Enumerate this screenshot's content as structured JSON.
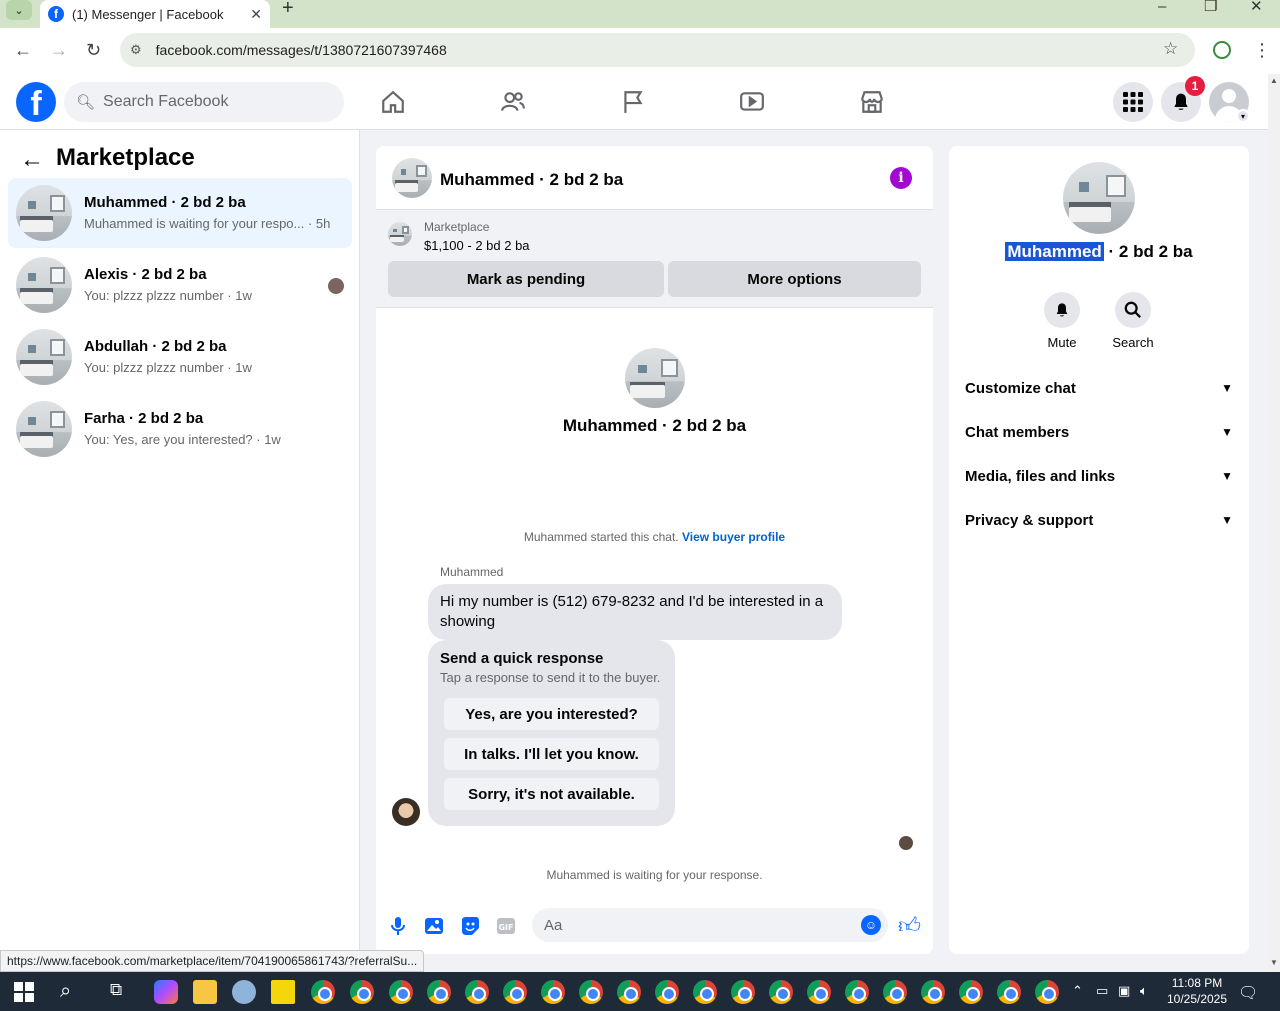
{
  "browser": {
    "tab_title": "(1) Messenger | Facebook",
    "tab_close": "✕",
    "new_tab": "+",
    "url": "facebook.com/messages/t/1380721607397468",
    "status_url": "https://www.facebook.com/marketplace/item/704190065861743/?referralSu..."
  },
  "header": {
    "search_placeholder": "Search Facebook",
    "notification_count": "1"
  },
  "left": {
    "title": "Marketplace",
    "conversations": [
      {
        "name": "Muhammed · 2 bd 2 ba",
        "preview": "Muhammed is waiting for your respo... · 5h",
        "active": true
      },
      {
        "name": "Alexis · 2 bd 2 ba",
        "preview": "You: plzzz plzzz number · 1w"
      },
      {
        "name": "Abdullah · 2 bd 2 ba",
        "preview": "You: plzzz plzzz number · 1w"
      },
      {
        "name": "Farha · 2 bd 2 ba",
        "preview": "You: Yes, are you interested? · 1w"
      }
    ]
  },
  "chat": {
    "title": "Muhammed · 2 bd 2 ba",
    "marketplace_label": "Marketplace",
    "listing": "$1,100 - 2 bd 2 ba",
    "mark_pending": "Mark as pending",
    "more_options": "More options",
    "profile_name": "Muhammed · 2 bd 2 ba",
    "started_text": "Muhammed started this chat.",
    "view_buyer_profile": "View buyer profile",
    "sender": "Muhammed",
    "message": "Hi my number is (512) 679-8232 and I'd be interested in a showing",
    "quick_title": "Send a quick response",
    "quick_sub": "Tap a response to send it to the buyer.",
    "quick_replies": [
      "Yes, are you interested?",
      "In talks. I'll let you know.",
      "Sorry, it's not available."
    ],
    "waiting": "Muhammed is waiting for your response.",
    "input_placeholder": "Aa"
  },
  "right": {
    "name_highlight": "Muhammed",
    "name_rest": " · 2 bd 2 ba",
    "mute": "Mute",
    "search": "Search",
    "rows": [
      "Customize chat",
      "Chat members",
      "Media, files and links",
      "Privacy & support"
    ]
  },
  "taskbar": {
    "time": "11:08 PM",
    "date": "10/25/2025"
  },
  "colors": {
    "brand": "#0866ff",
    "info": "#a309d3",
    "badge": "#e41e3f",
    "active_conv": "#ebf5ff"
  }
}
